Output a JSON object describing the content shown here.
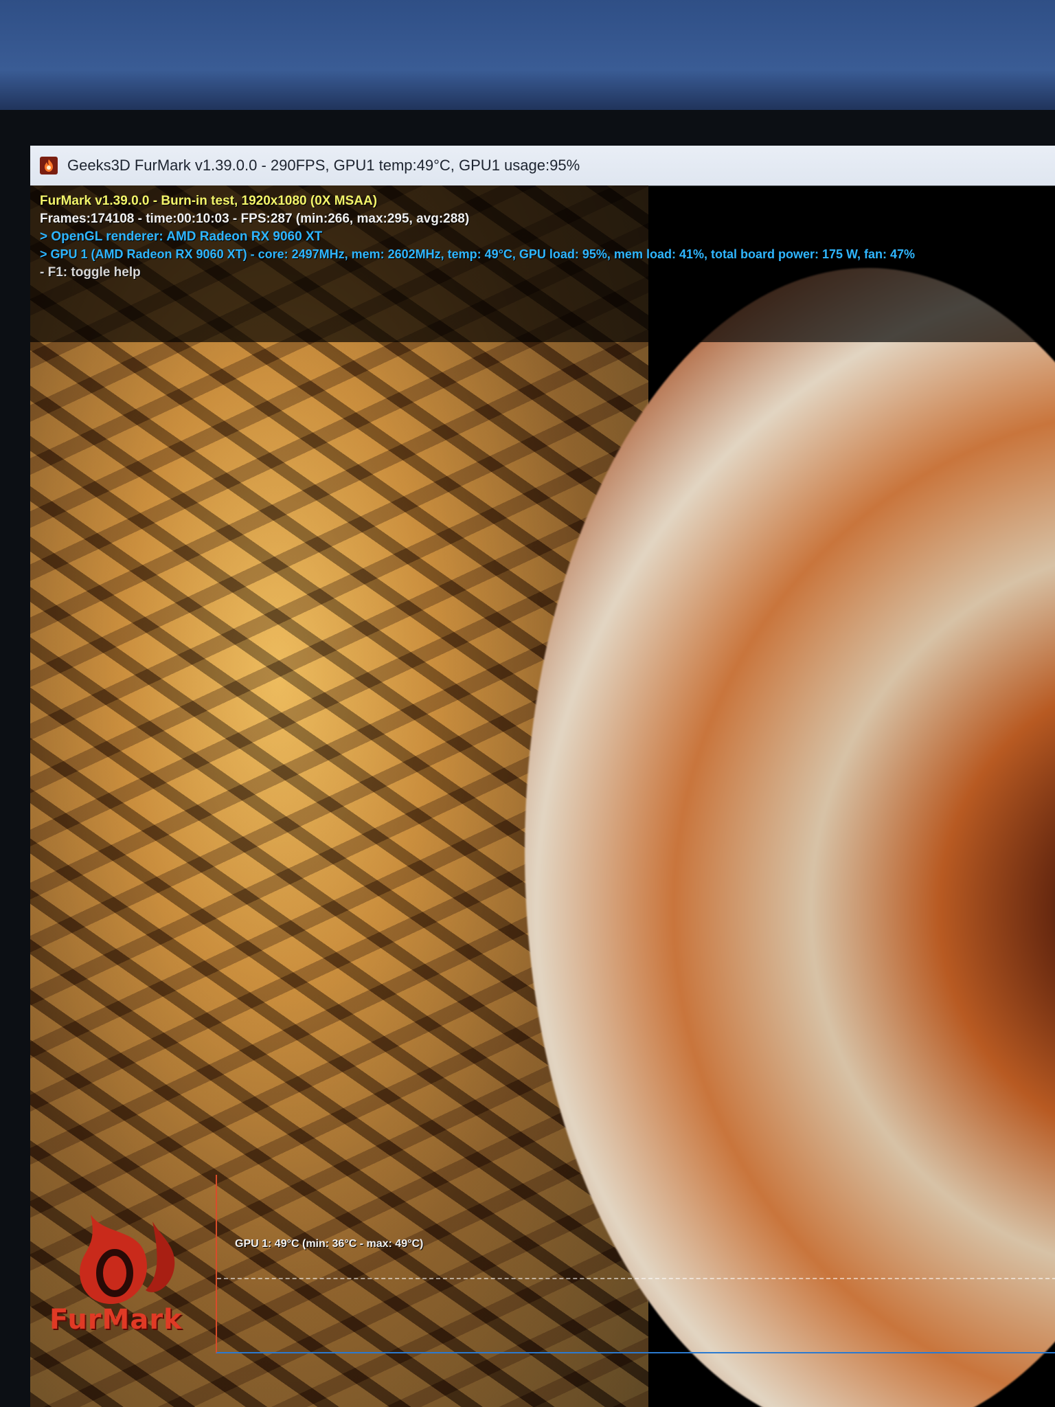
{
  "window": {
    "title": "Geeks3D FurMark v1.39.0.0 - 290FPS, GPU1 temp:49°C, GPU1 usage:95%"
  },
  "hud": {
    "line1": "FurMark v1.39.0.0 - Burn-in test, 1920x1080 (0X MSAA)",
    "line2": "Frames:174108 - time:00:10:03 - FPS:287 (min:266, max:295, avg:288)",
    "line3": "> OpenGL renderer: AMD Radeon RX 9060 XT",
    "line4": "> GPU 1 (AMD Radeon RX 9060 XT) - core: 2497MHz, mem: 2602MHz, temp: 49°C, GPU load: 95%, mem load: 41%, total board power: 175 W, fan: 47%",
    "line5": "- F1: toggle help"
  },
  "graph": {
    "label": "GPU 1: 49°C (min: 36°C - max: 49°C)"
  },
  "logo": {
    "text": "FurMark"
  },
  "colors": {
    "hud_yellow": "#f3f46a",
    "hud_cyan": "#2fb6ff",
    "logo_red": "#e03a25"
  },
  "icons": {
    "app": "furmark-flame-icon"
  }
}
